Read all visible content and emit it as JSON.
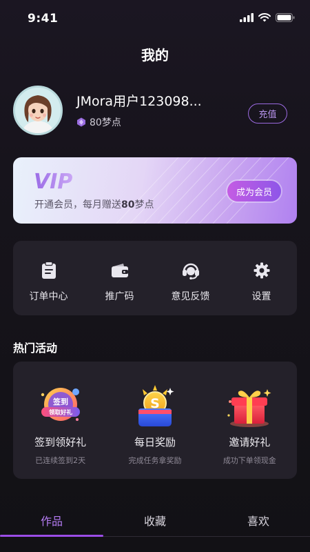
{
  "status_bar": {
    "time": "9:41"
  },
  "page_title": "我的",
  "profile": {
    "username": "JMora用户123098...",
    "points": "80梦点",
    "recharge_label": "充值"
  },
  "vip": {
    "logo_text": "VIP",
    "desc_prefix": "开通会员，每月赠送",
    "desc_highlight": "80",
    "desc_suffix": "梦点",
    "button_label": "成为会员"
  },
  "menu": {
    "items": [
      {
        "label": "订单中心",
        "icon": "clipboard-icon"
      },
      {
        "label": "推广码",
        "icon": "wallet-icon"
      },
      {
        "label": "意见反馈",
        "icon": "headset-icon"
      },
      {
        "label": "设置",
        "icon": "gear-icon"
      }
    ]
  },
  "activities": {
    "title": "热门活动",
    "items": [
      {
        "name": "签到领好礼",
        "sub": "已连续签到2天",
        "badge_top": "签到",
        "badge_bottom": "领取好礼",
        "icon": "checkin-badge-icon"
      },
      {
        "name": "每日奖励",
        "sub": "完成任务拿奖励",
        "coin": "S",
        "icon": "coin-chest-icon"
      },
      {
        "name": "邀请好礼",
        "sub": "成功下单领现金",
        "icon": "gift-box-icon"
      }
    ]
  },
  "tabs": {
    "items": [
      "作品",
      "收藏",
      "喜欢"
    ],
    "active": "作品"
  },
  "colors": {
    "accent": "#9b4de6",
    "card_bg": "#24212a",
    "page_bg": "#17141c"
  }
}
